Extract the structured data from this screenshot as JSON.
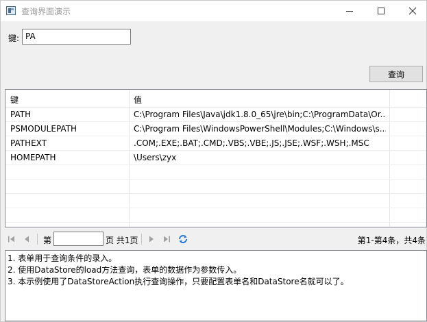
{
  "window": {
    "title": "查询界面演示"
  },
  "form": {
    "key_label": "键:",
    "key_value": "PA",
    "query_label": "查询"
  },
  "grid": {
    "headers": [
      "键",
      "值"
    ],
    "rows": [
      {
        "key": "PATH",
        "value": "C:\\Program Files\\Java\\jdk1.8.0_65\\jre\\bin;C:\\ProgramData\\Or..."
      },
      {
        "key": "PSMODULEPATH",
        "value": "C:\\Program Files\\WindowsPowerShell\\Modules;C:\\Windows\\s..."
      },
      {
        "key": "PATHEXT",
        "value": ".COM;.EXE;.BAT;.CMD;.VBS;.VBE;.JS;.JSE;.WSF;.WSH;.MSC"
      },
      {
        "key": "HOMEPATH",
        "value": "\\Users\\zyx"
      }
    ]
  },
  "pager": {
    "page_prefix": "第",
    "page_suffix": "页 共1页",
    "info": "第1-第4条，共4条",
    "icons": [
      "first-page-icon",
      "prev-page-icon",
      "next-page-icon",
      "last-page-icon",
      "refresh-icon"
    ]
  },
  "notes": {
    "lines": [
      "1. 表单用于查询条件的录入。",
      "2. 使用DataStore的load方法查询，表单的数据作为参数传入。",
      "3. 本示例使用了DataStoreAction执行查询操作，只要配置表单名和DataStore名就可以了。"
    ]
  }
}
